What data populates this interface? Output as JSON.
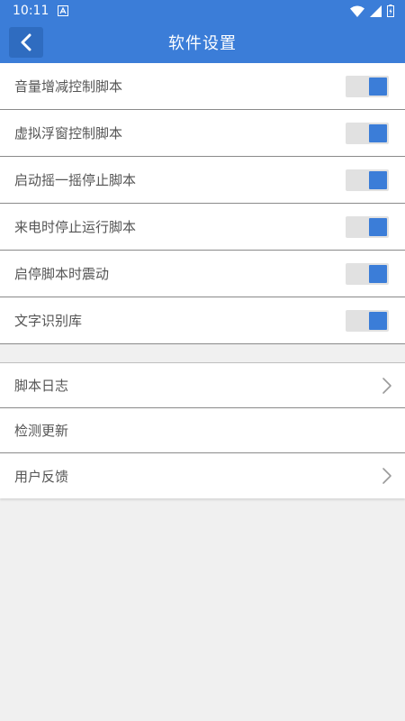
{
  "status_bar": {
    "time": "10:11",
    "icons": [
      "notification-a-icon",
      "wifi-icon",
      "signal-icon",
      "battery-icon"
    ]
  },
  "header": {
    "title": "软件设置",
    "back_icon": "chevron-left-icon"
  },
  "toggle_settings": [
    {
      "label": "音量增减控制脚本",
      "enabled": true
    },
    {
      "label": "虚拟浮窗控制脚本",
      "enabled": true
    },
    {
      "label": "启动摇一摇停止脚本",
      "enabled": true
    },
    {
      "label": "来电时停止运行脚本",
      "enabled": true
    },
    {
      "label": "启停脚本时震动",
      "enabled": true
    },
    {
      "label": "文字识别库",
      "enabled": true
    }
  ],
  "link_settings": [
    {
      "label": "脚本日志",
      "has_chevron": true
    },
    {
      "label": "检测更新",
      "has_chevron": false
    },
    {
      "label": "用户反馈",
      "has_chevron": true
    }
  ],
  "colors": {
    "primary": "#3b7dd8",
    "toggle_track": "#e1e1e1",
    "background": "#f0f0f0",
    "text": "#555555"
  }
}
